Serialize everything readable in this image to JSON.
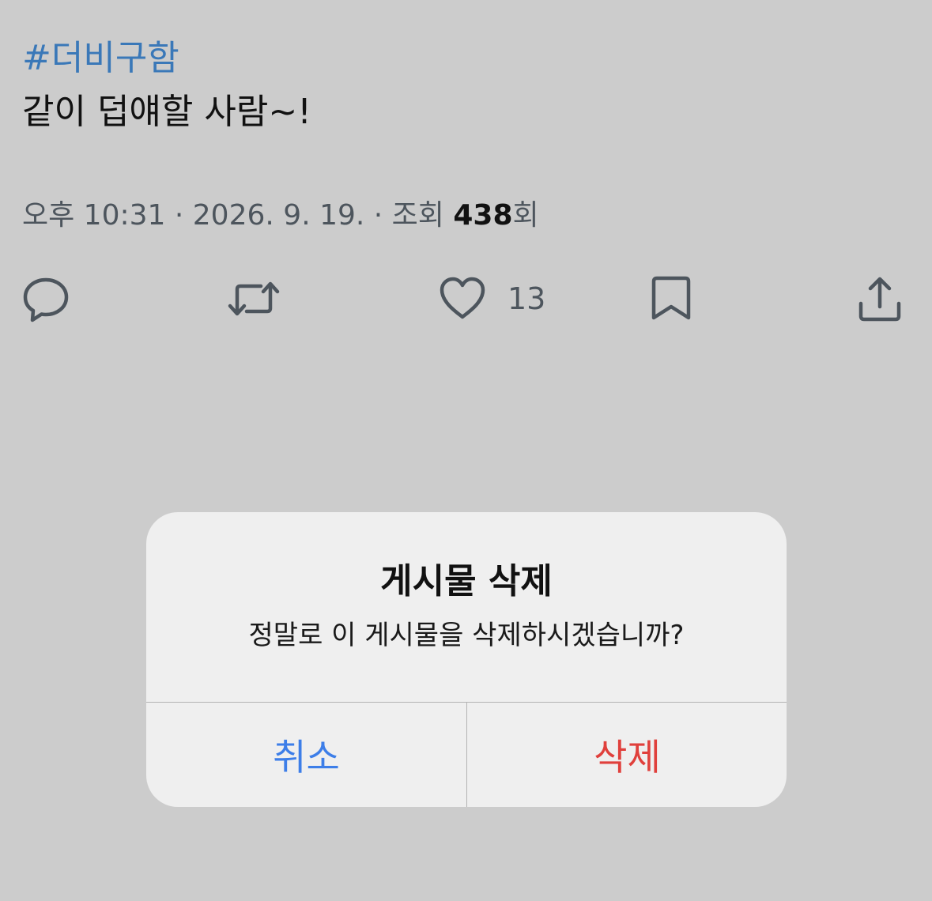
{
  "post": {
    "hashtag": "#더비구함",
    "text": "같이 덥얘할 사람~!"
  },
  "meta": {
    "time": "오후 10:31",
    "separator1": " · ",
    "date": "2026. 9. 19.",
    "separator2": " · ",
    "views_label": "조회 ",
    "views_count": "438",
    "views_suffix": "회"
  },
  "actions": {
    "reply_icon": "reply-icon",
    "retweet_icon": "retweet-icon",
    "like_icon": "heart-icon",
    "like_count": "13",
    "bookmark_icon": "bookmark-icon",
    "share_icon": "share-icon"
  },
  "dialog": {
    "title": "게시물 삭제",
    "message": "정말로 이 게시물을 삭제하시겠습니까?",
    "cancel_label": "취소",
    "delete_label": "삭제"
  },
  "colors": {
    "background": "#cccccc",
    "hashtag": "#3a78b8",
    "icon": "#4d555d",
    "cancel": "#3d7ee8",
    "delete": "#e0403c",
    "dialog_bg": "#efefef"
  }
}
